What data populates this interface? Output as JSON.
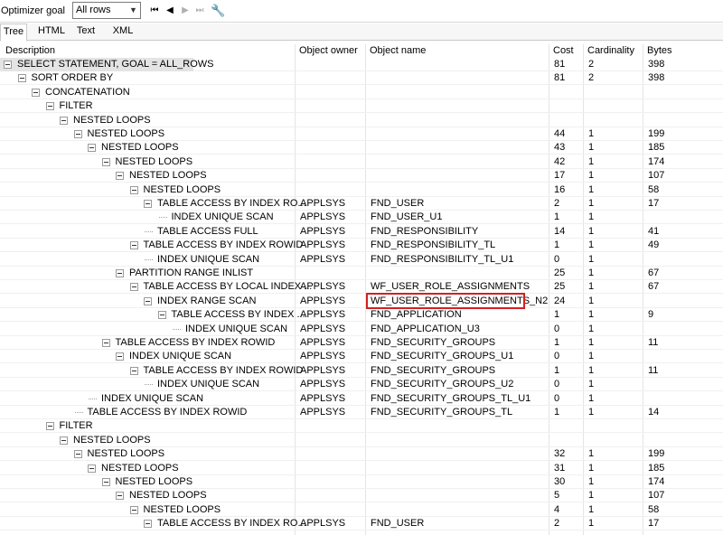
{
  "toolbar": {
    "goal_label": "Optimizer goal",
    "goal_value": "All rows",
    "buttons": [
      "first-icon",
      "prev-icon",
      "next-icon",
      "last-icon",
      "wrench-icon"
    ]
  },
  "tabs": [
    "Tree",
    "HTML",
    "Text",
    "XML"
  ],
  "active_tab": "Tree",
  "columns": [
    "Description",
    "Object owner",
    "Object name",
    "Cost",
    "Cardinality",
    "Bytes"
  ],
  "highlight_color": "#d32020",
  "rows": [
    {
      "depth": 0,
      "expandable": true,
      "desc": "SELECT STATEMENT, GOAL = ALL_ROWS",
      "owner": "",
      "name": "",
      "cost": "81",
      "card": "2",
      "bytes": "398"
    },
    {
      "depth": 1,
      "expandable": true,
      "desc": "SORT ORDER BY",
      "owner": "",
      "name": "",
      "cost": "81",
      "card": "2",
      "bytes": "398"
    },
    {
      "depth": 2,
      "expandable": true,
      "desc": "CONCATENATION",
      "owner": "",
      "name": "",
      "cost": "",
      "card": "",
      "bytes": ""
    },
    {
      "depth": 3,
      "expandable": true,
      "desc": "FILTER",
      "owner": "",
      "name": "",
      "cost": "",
      "card": "",
      "bytes": ""
    },
    {
      "depth": 4,
      "expandable": true,
      "desc": "NESTED LOOPS",
      "owner": "",
      "name": "",
      "cost": "",
      "card": "",
      "bytes": ""
    },
    {
      "depth": 5,
      "expandable": true,
      "desc": "NESTED LOOPS",
      "owner": "",
      "name": "",
      "cost": "44",
      "card": "1",
      "bytes": "199"
    },
    {
      "depth": 6,
      "expandable": true,
      "desc": "NESTED LOOPS",
      "owner": "",
      "name": "",
      "cost": "43",
      "card": "1",
      "bytes": "185"
    },
    {
      "depth": 7,
      "expandable": true,
      "desc": "NESTED LOOPS",
      "owner": "",
      "name": "",
      "cost": "42",
      "card": "1",
      "bytes": "174"
    },
    {
      "depth": 8,
      "expandable": true,
      "desc": "NESTED LOOPS",
      "owner": "",
      "name": "",
      "cost": "17",
      "card": "1",
      "bytes": "107"
    },
    {
      "depth": 9,
      "expandable": true,
      "desc": "NESTED LOOPS",
      "owner": "",
      "name": "",
      "cost": "16",
      "card": "1",
      "bytes": "58"
    },
    {
      "depth": 10,
      "expandable": true,
      "desc": "TABLE ACCESS BY INDEX RO...",
      "owner": "APPLSYS",
      "name": "FND_USER",
      "cost": "2",
      "card": "1",
      "bytes": "17"
    },
    {
      "depth": 11,
      "expandable": false,
      "desc": "INDEX UNIQUE SCAN",
      "owner": "APPLSYS",
      "name": "FND_USER_U1",
      "cost": "1",
      "card": "1",
      "bytes": ""
    },
    {
      "depth": 10,
      "expandable": false,
      "desc": "TABLE ACCESS FULL",
      "owner": "APPLSYS",
      "name": "FND_RESPONSIBILITY",
      "cost": "14",
      "card": "1",
      "bytes": "41"
    },
    {
      "depth": 9,
      "expandable": true,
      "desc": "TABLE ACCESS BY INDEX ROWID",
      "owner": "APPLSYS",
      "name": "FND_RESPONSIBILITY_TL",
      "cost": "1",
      "card": "1",
      "bytes": "49"
    },
    {
      "depth": 10,
      "expandable": false,
      "desc": "INDEX UNIQUE SCAN",
      "owner": "APPLSYS",
      "name": "FND_RESPONSIBILITY_TL_U1",
      "cost": "0",
      "card": "1",
      "bytes": ""
    },
    {
      "depth": 8,
      "expandable": true,
      "desc": "PARTITION RANGE INLIST",
      "owner": "",
      "name": "",
      "cost": "25",
      "card": "1",
      "bytes": "67"
    },
    {
      "depth": 9,
      "expandable": true,
      "desc": "TABLE ACCESS BY LOCAL INDEX ...",
      "owner": "APPLSYS",
      "name": "WF_USER_ROLE_ASSIGNMENTS",
      "cost": "25",
      "card": "1",
      "bytes": "67"
    },
    {
      "depth": 10,
      "expandable": true,
      "desc": "INDEX RANGE SCAN",
      "owner": "APPLSYS",
      "name": "WF_USER_ROLE_ASSIGNMENTS_N2",
      "cost": "24",
      "card": "1",
      "bytes": "",
      "highlight": true
    },
    {
      "depth": 11,
      "expandable": true,
      "desc": "TABLE ACCESS BY INDEX ...",
      "owner": "APPLSYS",
      "name": "FND_APPLICATION",
      "cost": "1",
      "card": "1",
      "bytes": "9"
    },
    {
      "depth": 12,
      "expandable": false,
      "desc": "INDEX UNIQUE SCAN",
      "owner": "APPLSYS",
      "name": "FND_APPLICATION_U3",
      "cost": "0",
      "card": "1",
      "bytes": ""
    },
    {
      "depth": 7,
      "expandable": true,
      "desc": "TABLE ACCESS BY INDEX ROWID",
      "owner": "APPLSYS",
      "name": "FND_SECURITY_GROUPS",
      "cost": "1",
      "card": "1",
      "bytes": "11"
    },
    {
      "depth": 8,
      "expandable": true,
      "desc": "INDEX UNIQUE SCAN",
      "owner": "APPLSYS",
      "name": "FND_SECURITY_GROUPS_U1",
      "cost": "0",
      "card": "1",
      "bytes": ""
    },
    {
      "depth": 9,
      "expandable": true,
      "desc": "TABLE ACCESS BY INDEX ROWID",
      "owner": "APPLSYS",
      "name": "FND_SECURITY_GROUPS",
      "cost": "1",
      "card": "1",
      "bytes": "11"
    },
    {
      "depth": 10,
      "expandable": false,
      "desc": "INDEX UNIQUE SCAN",
      "owner": "APPLSYS",
      "name": "FND_SECURITY_GROUPS_U2",
      "cost": "0",
      "card": "1",
      "bytes": ""
    },
    {
      "depth": 6,
      "expandable": false,
      "desc": "INDEX UNIQUE SCAN",
      "owner": "APPLSYS",
      "name": "FND_SECURITY_GROUPS_TL_U1",
      "cost": "0",
      "card": "1",
      "bytes": ""
    },
    {
      "depth": 5,
      "expandable": false,
      "desc": "TABLE ACCESS BY INDEX ROWID",
      "owner": "APPLSYS",
      "name": "FND_SECURITY_GROUPS_TL",
      "cost": "1",
      "card": "1",
      "bytes": "14"
    },
    {
      "depth": 3,
      "expandable": true,
      "desc": "FILTER",
      "owner": "",
      "name": "",
      "cost": "",
      "card": "",
      "bytes": ""
    },
    {
      "depth": 4,
      "expandable": true,
      "desc": "NESTED LOOPS",
      "owner": "",
      "name": "",
      "cost": "",
      "card": "",
      "bytes": ""
    },
    {
      "depth": 5,
      "expandable": true,
      "desc": "NESTED LOOPS",
      "owner": "",
      "name": "",
      "cost": "32",
      "card": "1",
      "bytes": "199"
    },
    {
      "depth": 6,
      "expandable": true,
      "desc": "NESTED LOOPS",
      "owner": "",
      "name": "",
      "cost": "31",
      "card": "1",
      "bytes": "185"
    },
    {
      "depth": 7,
      "expandable": true,
      "desc": "NESTED LOOPS",
      "owner": "",
      "name": "",
      "cost": "30",
      "card": "1",
      "bytes": "174"
    },
    {
      "depth": 8,
      "expandable": true,
      "desc": "NESTED LOOPS",
      "owner": "",
      "name": "",
      "cost": "5",
      "card": "1",
      "bytes": "107"
    },
    {
      "depth": 9,
      "expandable": true,
      "desc": "NESTED LOOPS",
      "owner": "",
      "name": "",
      "cost": "4",
      "card": "1",
      "bytes": "58"
    },
    {
      "depth": 10,
      "expandable": true,
      "desc": "TABLE ACCESS BY INDEX RO...",
      "owner": "APPLSYS",
      "name": "FND_USER",
      "cost": "2",
      "card": "1",
      "bytes": "17"
    }
  ]
}
